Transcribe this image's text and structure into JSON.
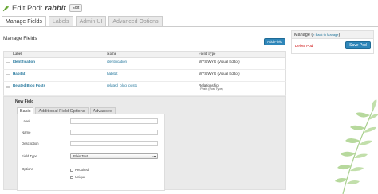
{
  "header": {
    "title_prefix": "Edit Pod: ",
    "pod_name": "rabbit",
    "edit_label": "Edit"
  },
  "tabs": [
    {
      "label": "Manage Fields",
      "active": true
    },
    {
      "label": "Labels",
      "active": false
    },
    {
      "label": "Admin UI",
      "active": false
    },
    {
      "label": "Advanced Options",
      "active": false
    }
  ],
  "main": {
    "section_title": "Manage Fields",
    "add_field_label": "Add Field",
    "columns": [
      "Label",
      "Name",
      "Field Type"
    ],
    "rows": [
      {
        "label": "Identification",
        "name": "identification",
        "type": "WYSIWYG (Visual Editor)",
        "type_note": ""
      },
      {
        "label": "Habitat",
        "name": "habitat",
        "type": "WYSIWYG (Visual Editor)",
        "type_note": ""
      },
      {
        "label": "Related Blog Posts",
        "name": "related_blog_posts",
        "type": "Relationship",
        "type_note": "• Posts (Post Type)"
      }
    ]
  },
  "new_field": {
    "title": "New Field",
    "subtabs": [
      "Basic",
      "Additional Field Options",
      "Advanced"
    ],
    "form": {
      "label": "Label",
      "name": "Name",
      "description": "Description",
      "field_type": "Field Type",
      "field_type_value": "Plain Text",
      "options": "Options",
      "required": "Required",
      "unique": "Unique"
    }
  },
  "sidebar": {
    "title": "Manage",
    "back_link": "« Back to Manage",
    "delete_label": "Delete Pod",
    "save_label": "Save Pod"
  },
  "colors": {
    "primary_button": "#2e86b9",
    "link": "#21759b",
    "delete": "#cc0000",
    "leaf": "#a8cf8e"
  }
}
